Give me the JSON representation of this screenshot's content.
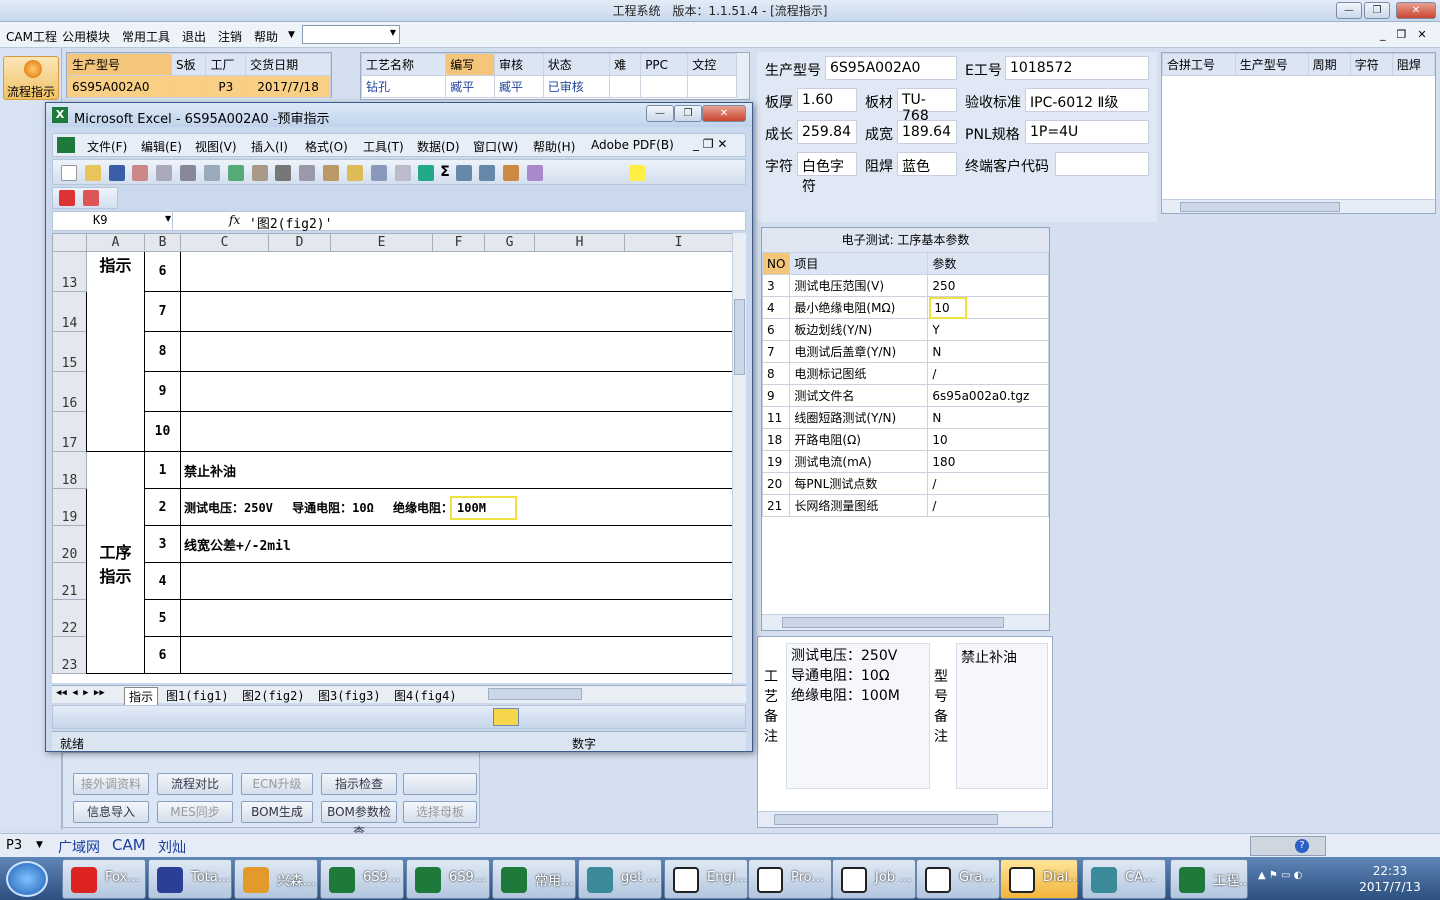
{
  "window": {
    "title": "工程系统　版本：1.1.51.4 - [流程指示]"
  },
  "menu": [
    "CAM工程",
    "公用模块",
    "常用工具",
    "退出",
    "注销",
    "帮助"
  ],
  "left_icon": {
    "label": "流程指示"
  },
  "top_table": {
    "headers": [
      "生产型号",
      "S板",
      "工厂",
      "交货日期"
    ],
    "row": [
      "6S95A002A0",
      "",
      "P3",
      "2017/7/18"
    ]
  },
  "process_table": {
    "headers": [
      "工艺名称",
      "编写",
      "审核",
      "状态",
      "难",
      "PPC",
      "文控"
    ],
    "row": [
      "钻孔",
      "臧平",
      "臧平",
      "已审核",
      "",
      "",
      ""
    ]
  },
  "excel": {
    "title": "Microsoft Excel - 6S95A002A0 -预审指示",
    "menu": [
      "文件(F)",
      "编辑(E)",
      "视图(V)",
      "插入(I)",
      "格式(O)",
      "工具(T)",
      "数据(D)",
      "窗口(W)",
      "帮助(H)",
      "Adobe PDF(B)"
    ],
    "namebox": "K9",
    "fx": "fx",
    "formula": "'图2(fig2)'",
    "columns": [
      "A",
      "B",
      "C",
      "D",
      "E",
      "F",
      "G",
      "H",
      "I"
    ],
    "rows": [
      {
        "n": "13",
        "b": "6",
        "c": ""
      },
      {
        "n": "14",
        "b": "7",
        "c": ""
      },
      {
        "n": "15",
        "b": "8",
        "c": ""
      },
      {
        "n": "16",
        "b": "9",
        "c": ""
      },
      {
        "n": "17",
        "b": "10",
        "c": ""
      },
      {
        "n": "18",
        "b": "1",
        "c": "禁止补油"
      },
      {
        "n": "19",
        "b": "2",
        "c": "测试电压：250V　 导通电阻：10Ω　 绝缘电阻："
      },
      {
        "n": "20",
        "b": "3",
        "c": "线宽公差+/-2mil"
      },
      {
        "n": "21",
        "b": "4",
        "c": ""
      },
      {
        "n": "22",
        "b": "5",
        "c": ""
      },
      {
        "n": "23",
        "b": "6",
        "c": ""
      }
    ],
    "groupA1": "指示",
    "groupA2": "工序\n指示",
    "insulation_value": "100M",
    "tabs": [
      "指示",
      "图1(fig1)",
      "图2(fig2)",
      "图3(fig3)",
      "图4(fig4)"
    ],
    "status": "就绪",
    "status2": "数字"
  },
  "bottom_buttons": [
    {
      "label": "接外调资料",
      "disabled": true
    },
    {
      "label": "流程对比",
      "disabled": false
    },
    {
      "label": "ECN升级",
      "disabled": true
    },
    {
      "label": "指示检查",
      "disabled": false
    },
    {
      "label": "",
      "disabled": false
    },
    {
      "label": "信息导入",
      "disabled": false
    },
    {
      "label": "MES同步",
      "disabled": true
    },
    {
      "label": "BOM生成",
      "disabled": false
    },
    {
      "label": "BOM参数检查",
      "disabled": false
    },
    {
      "label": "选择母板",
      "disabled": true
    }
  ],
  "info": {
    "生产型号": "6S95A002A0",
    "E工号": "1018572",
    "板厚": "1.60",
    "板材": "TU-768",
    "验收标准": "IPC-6012 Ⅱ级",
    "成长": "259.84",
    "成宽": "189.64",
    "PNL规格": "1P=4U",
    "字符": "白色字符",
    "阻焊": "蓝色",
    "终端客户代码": ""
  },
  "merge_table": {
    "headers": [
      "合拼工号",
      "生产型号",
      "周期",
      "字符",
      "阻焊"
    ]
  },
  "param_panel": {
    "title": "电子测试: 工序基本参数",
    "headers": [
      "NO",
      "项目",
      "参数"
    ],
    "rows": [
      [
        "3",
        "测试电压范围(V)",
        "250"
      ],
      [
        "4",
        "最小绝缘电阻(MΩ)",
        "10"
      ],
      [
        "6",
        "板边划线(Y/N)",
        "Y"
      ],
      [
        "7",
        "电测试后盖章(Y/N)",
        "N"
      ],
      [
        "8",
        "电测标记图纸",
        "/"
      ],
      [
        "9",
        "测试文件名",
        "6s95a002a0.tgz"
      ],
      [
        "11",
        "线圈短路测试(Y/N)",
        "N"
      ],
      [
        "18",
        "开路电阻(Ω)",
        "10"
      ],
      [
        "19",
        "测试电流(mA)",
        "180"
      ],
      [
        "20",
        "每PNL测试点数",
        "/"
      ],
      [
        "21",
        "长网络测量图纸",
        "/"
      ]
    ]
  },
  "notes": {
    "process_label": "工艺备注",
    "process_text": [
      "测试电压：250V",
      "导通电阻：10Ω",
      "绝缘电阻：100M"
    ],
    "model_label": "型号备注",
    "model_text": "禁止补油"
  },
  "statusbar": [
    "P3",
    "广域网",
    "CAM",
    "刘灿"
  ],
  "taskbar": {
    "items": [
      "Fox...",
      "Tota...",
      "兴森...",
      "6S9...",
      "6S9...",
      "常用...",
      "get ...",
      "Engi...",
      "Pro...",
      "Job ...",
      "Gra...",
      "Dial...",
      "CA...",
      "工程..."
    ],
    "time": "22:33",
    "date": "2017/7/13"
  },
  "colors": {
    "accent": "#f3c26a",
    "highlight": "#f0e040",
    "excel_green": "#1d7a3a"
  }
}
